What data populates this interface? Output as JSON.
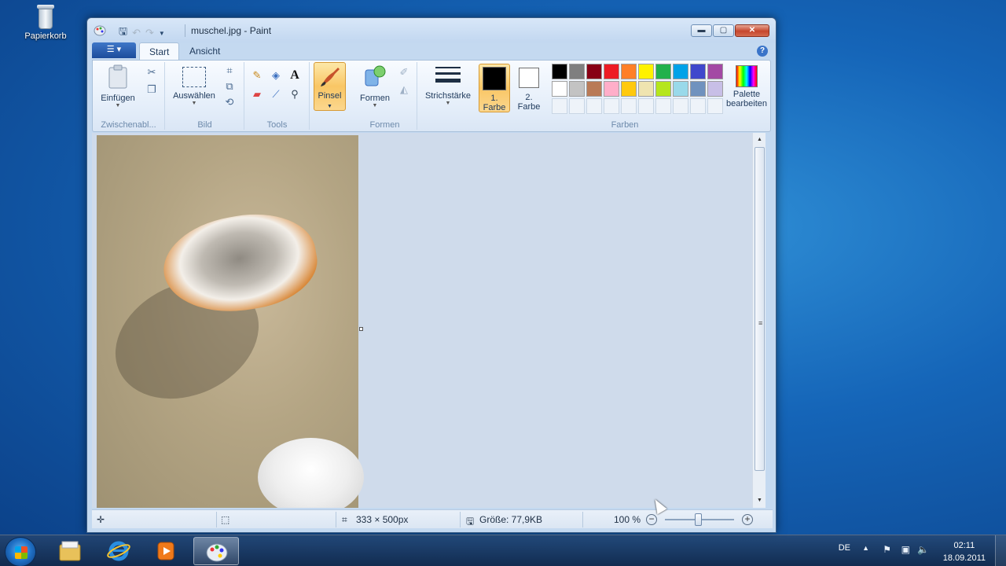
{
  "desktop": {
    "recycle_bin_label": "Papierkorb"
  },
  "window": {
    "title": "muschel.jpg - Paint",
    "controls": {
      "minimize": "▬",
      "maximize": "▢",
      "close": "✕"
    }
  },
  "ribbon": {
    "tabs": {
      "start": "Start",
      "view": "Ansicht"
    },
    "clipboard": {
      "paste_label": "Einfügen",
      "group_label": "Zwischenabl..."
    },
    "image": {
      "select_label": "Auswählen",
      "group_label": "Bild"
    },
    "tools": {
      "group_label": "Tools",
      "text_tool": "A"
    },
    "brushes": {
      "label": "Pinsel"
    },
    "shapes": {
      "label": "Formen",
      "group_label": "Formen"
    },
    "stroke": {
      "label": "Strichstärke"
    },
    "colors": {
      "color1_label_line1": "1.",
      "color1_label_line2": "Farbe",
      "color2_label_line1": "2.",
      "color2_label_line2": "Farbe",
      "group_label": "Farben",
      "edit_label_line1": "Palette",
      "edit_label_line2": "bearbeiten",
      "color1": "#000000",
      "color2": "#ffffff",
      "palette_row1": [
        "#000000",
        "#7f7f7f",
        "#880015",
        "#ed1c24",
        "#ff7f27",
        "#fff200",
        "#22b14c",
        "#00a2e8",
        "#3f48cc",
        "#a349a4"
      ],
      "palette_row2": [
        "#ffffff",
        "#c3c3c3",
        "#b97a57",
        "#ffaec9",
        "#ffc90e",
        "#efe4b0",
        "#b5e61d",
        "#99d9ea",
        "#7092be",
        "#c8bfe7"
      ]
    }
  },
  "statusbar": {
    "dimensions": "333 × 500px",
    "size": "Größe: 77,9KB",
    "zoom": "100 %"
  },
  "taskbar": {
    "language": "DE",
    "time": "02:11",
    "date": "18.09.2011"
  }
}
